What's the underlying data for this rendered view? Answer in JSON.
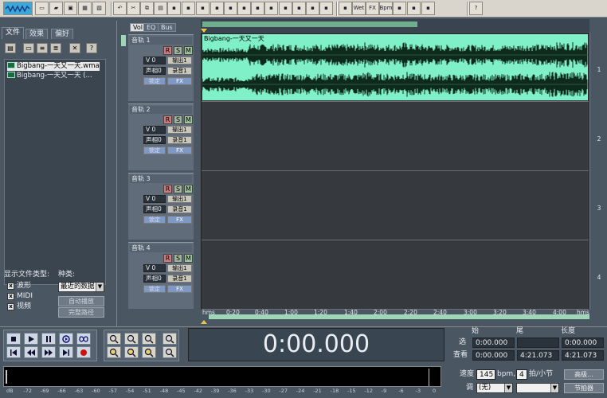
{
  "toolbar": {
    "buttons": [
      "wave-mode-icon",
      "new-icon",
      "open-icon",
      "close-icon",
      "save-icon",
      "save-as-icon",
      "undo-icon",
      "cut-icon",
      "copy-icon",
      "paste-icon",
      "mix-icon",
      "trim-icon",
      "silence-icon",
      "insert-icon",
      "multi-icon",
      "edit-icon",
      "envelope-icon",
      "noise-icon",
      "effects-icon",
      "spectrum-icon",
      "loop-icon",
      "settings-icon",
      "stretch-icon",
      "wet-icon",
      "fx-icon",
      "bpm-icon",
      "export-icon",
      "device-icon",
      "cd-icon",
      "help-icon"
    ],
    "wet_label": "Wet",
    "fx_label": "FX",
    "bpm_label": "Bpm"
  },
  "left": {
    "tabs": [
      "文件",
      "效果",
      "偏好"
    ],
    "files": [
      "Bigbang-一天又一天.wma",
      "Bigbang-一天又一天 (..."
    ],
    "show_types_label": "显示文件类型:",
    "kind_label": "种类:",
    "types": [
      {
        "check": "x",
        "label": "波形"
      },
      {
        "check": "x",
        "label": "MIDI"
      },
      {
        "check": "x",
        "label": "视频"
      }
    ],
    "kind_value": "最近的数据",
    "auto_play": "自动播放",
    "full_path": "完整路径"
  },
  "tracks": {
    "view_tabs": [
      "Vol",
      "EQ",
      "Bus"
    ],
    "items": [
      {
        "name": "音轨 1",
        "vol": "V 0",
        "pan": "声相0",
        "out": "输出1",
        "rec": "录音1",
        "lock": "锁定",
        "fx": "FX"
      },
      {
        "name": "音轨 2",
        "vol": "V 0",
        "pan": "声相0",
        "out": "输出1",
        "rec": "录音1",
        "lock": "锁定",
        "fx": "FX"
      },
      {
        "name": "音轨 3",
        "vol": "V 0",
        "pan": "声相0",
        "out": "输出1",
        "rec": "录音1",
        "lock": "锁定",
        "fx": "FX"
      },
      {
        "name": "音轨 4",
        "vol": "V 0",
        "pan": "声相0",
        "out": "输出1",
        "rec": "录音1",
        "lock": "锁定",
        "fx": "FX"
      }
    ],
    "clip_name": "Bigbang-一天又一天",
    "lane_numbers": [
      "1",
      "2",
      "3",
      "4"
    ]
  },
  "ruler": [
    "hms",
    "0:20",
    "0:40",
    "1:00",
    "1:20",
    "1:40",
    "2:00",
    "2:20",
    "2:40",
    "3:00",
    "3:20",
    "3:40",
    "4:00",
    "hms"
  ],
  "transport": {
    "time": "0:00.000",
    "begin_label": "始",
    "end_label": "尾",
    "length_label": "长度",
    "sel_label": "选",
    "view_label": "查看",
    "sel_begin": "0:00.000",
    "sel_end": "",
    "sel_length": "0:00.000",
    "view_begin": "0:00.000",
    "view_end": "4:21.073",
    "view_length": "4:21.073",
    "tempo_label": "速度",
    "tempo": "145",
    "bpm": "bpm,",
    "beats": "4",
    "beats_label": "拍/小节",
    "key_label": "调",
    "key_value": "(无)",
    "advanced": "高级...",
    "metronome": "节拍器"
  },
  "meter_scale": [
    "dB",
    "-72",
    "-69",
    "-66",
    "-63",
    "-60",
    "-57",
    "-54",
    "-51",
    "-48",
    "-45",
    "-42",
    "-39",
    "-36",
    "-33",
    "-30",
    "-27",
    "-24",
    "-21",
    "-18",
    "-15",
    "-12",
    "-9",
    "-6",
    "-3",
    "0"
  ],
  "colors": {
    "waveform": "#5fe8b4",
    "wave_bg": "#7ff0c8",
    "panel": "#4b5663"
  }
}
